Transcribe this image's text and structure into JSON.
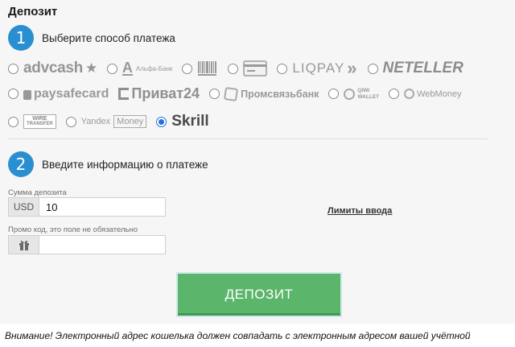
{
  "page": {
    "title": "Депозит"
  },
  "step1": {
    "number": "1",
    "label": "Выберите способ платежа"
  },
  "step2": {
    "number": "2",
    "label": "Введите информацию о платеже"
  },
  "payment_methods": {
    "row1": [
      {
        "id": "advcash",
        "text": "advcash",
        "extra": "★",
        "selected": false
      },
      {
        "id": "alfabank",
        "text": "Альфа-Банк",
        "extra": "А",
        "selected": false
      },
      {
        "id": "barcode",
        "text": "",
        "icon": "barcode-icon",
        "selected": false
      },
      {
        "id": "card",
        "text": "",
        "icon": "bank-card-icon",
        "selected": false
      },
      {
        "id": "liqpay",
        "text": "LIQPAY",
        "extra": "»",
        "selected": false
      },
      {
        "id": "neteller",
        "text": "NETELLER",
        "extra": "",
        "selected": false
      }
    ],
    "row2": [
      {
        "id": "paysafecard",
        "text": "paysafecard",
        "selected": false
      },
      {
        "id": "privat24",
        "text": "Приват24",
        "selected": false
      },
      {
        "id": "promsvyazbank",
        "text": "Промсвязьбанк",
        "selected": false
      },
      {
        "id": "qiwi",
        "text": "QIWI",
        "text2": "WALLET",
        "selected": false
      },
      {
        "id": "webmoney",
        "text": "WebMoney",
        "selected": false
      }
    ],
    "row3": [
      {
        "id": "wire",
        "text": "WIRE",
        "text2": "TRANSFER",
        "selected": false
      },
      {
        "id": "yandex",
        "text": "Yandex",
        "text2": "Money",
        "selected": false
      },
      {
        "id": "skrill",
        "text": "Skrill",
        "selected": true
      }
    ]
  },
  "form": {
    "amount_label": "Сумма депозита",
    "currency": "USD",
    "amount_value": "10",
    "promo_label": "Промо код, это поле не обязательно",
    "promo_value": "",
    "limits_link": "Лимиты ввода",
    "submit_label": "ДЕПОЗИТ"
  },
  "notice": "Внимание! Электронный адрес кошелька должен совпадать с электронным адресом вашей учётной",
  "colors": {
    "step_badge": "#2a8fd0",
    "button": "#5bb56a",
    "radio_selected": "#1e73d9"
  }
}
